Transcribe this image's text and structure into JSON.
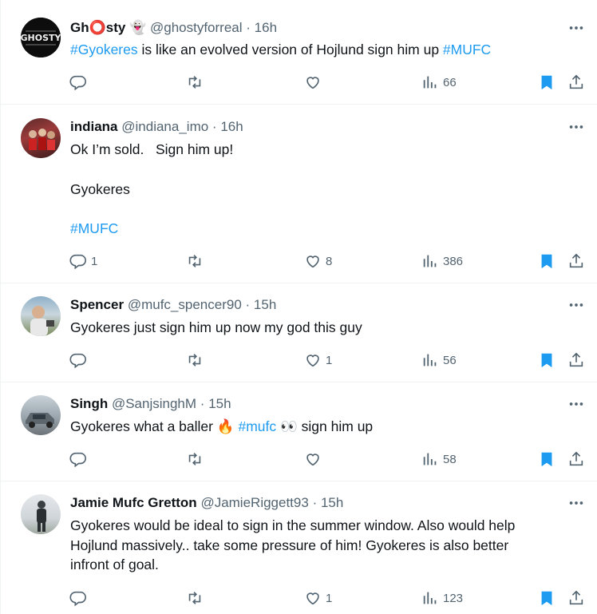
{
  "colors": {
    "link": "#1d9bf0",
    "secondary": "#536471",
    "bookmark": "#1d9bf0"
  },
  "tweets": [
    {
      "name": "Gh⭕sty 👻",
      "handle": "@ghostyforreal",
      "time": "16h",
      "avatar": "ghosty-logo",
      "text_html_parts": [
        {
          "type": "link",
          "text": "#Gyokeres"
        },
        {
          "type": "text",
          "text": " is like an evolved version of Hojlund sign him up "
        },
        {
          "type": "link",
          "text": "#MUFC"
        }
      ],
      "reply_count": "",
      "retweet_count": "",
      "like_count": "",
      "views": "66"
    },
    {
      "name": "indiana",
      "handle": "@indiana_imo",
      "time": "16h",
      "avatar": "people-photo",
      "line1": "Ok I’m sold.   Sign him up!",
      "line2": "Gyokeres",
      "line3": "#MUFC",
      "reply_count": "1",
      "retweet_count": "",
      "like_count": "8",
      "views": "386"
    },
    {
      "name": "Spencer",
      "handle": "@mufc_spencer90",
      "time": "15h",
      "avatar": "man-photo",
      "text": "Gyokeres just sign him up now my god this guy",
      "reply_count": "",
      "retweet_count": "",
      "like_count": "1",
      "views": "56"
    },
    {
      "name": "Singh",
      "handle": "@SanjsinghM",
      "time": "15h",
      "avatar": "car-photo",
      "text_a": "Gyokeres what a baller 🔥 ",
      "link": "#mufc",
      "text_b": " 👀 sign him up",
      "reply_count": "",
      "retweet_count": "",
      "like_count": "",
      "views": "58"
    },
    {
      "name": "Jamie Mufc Gretton",
      "handle": "@JamieRiggett93",
      "time": "15h",
      "avatar": "person-standing-photo",
      "line1": "Gyokeres would be ideal to sign in the summer window. Also would help",
      "line2": "Hojlund massively.. take some pressure of him! Gyokeres is also better",
      "line3": "infront of goal.",
      "reply_count": "",
      "retweet_count": "",
      "like_count": "1",
      "views": "123"
    }
  ]
}
